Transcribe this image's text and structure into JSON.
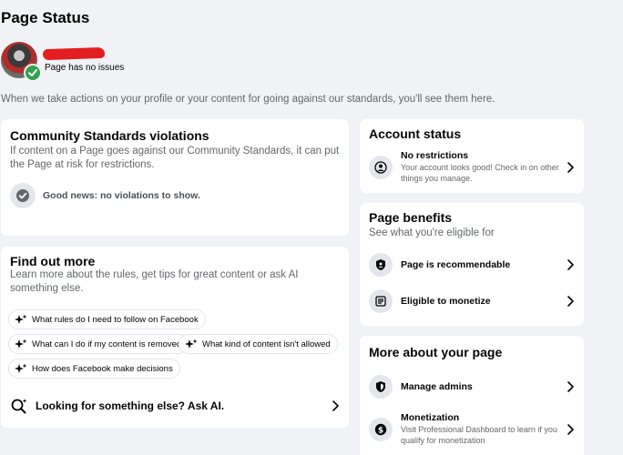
{
  "header": {
    "title": "Page Status",
    "page_status": "Page has no issues",
    "intro": "When we take actions on your profile or your content for going against our standards, you'll see them here."
  },
  "violations": {
    "title": "Community Standards violations",
    "description": "If content on a Page goes against our Community Standards, it can put the Page at risk for restrictions.",
    "good_news": "Good news: no violations to show."
  },
  "find_out_more": {
    "title": "Find out more",
    "description": "Learn more about the rules, get tips for great content or ask AI something else.",
    "chips": [
      "What rules do I need to follow on Facebook",
      "What can I do if my content is removed",
      "What kind of content isn't allowed",
      "How does Facebook make decisions"
    ],
    "ask_label": "Looking for something else? Ask AI."
  },
  "account_status": {
    "title": "Account status",
    "item_label": "No restrictions",
    "item_desc": "Your account looks good! Check in on other things you manage."
  },
  "page_benefits": {
    "title": "Page benefits",
    "subtitle": "See what you're eligible for",
    "items": [
      {
        "label": "Page is recommendable",
        "icon": "shield-icon"
      },
      {
        "label": "Eligible to monetize",
        "icon": "monetize-icon"
      }
    ]
  },
  "more_about": {
    "title": "More about your page",
    "items": [
      {
        "label": "Manage admins",
        "desc": "",
        "icon": "admin-shield-icon"
      },
      {
        "label": "Monetization",
        "desc": "Visit Professional Dashboard to learn if you qualify for monetization",
        "icon": "dollar-icon"
      }
    ]
  },
  "colors": {
    "background": "#f0f2f5",
    "card": "#ffffff",
    "success": "#31a24c",
    "secondary_text": "#65676b"
  }
}
